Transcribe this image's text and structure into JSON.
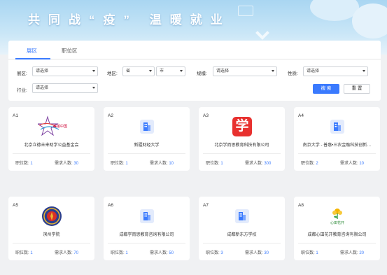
{
  "banner": {
    "slogan": "共同战“疫” 温暖就业"
  },
  "tabs": [
    {
      "label": "展区"
    },
    {
      "label": "职位区"
    }
  ],
  "filters": {
    "zone_label": "展区:",
    "zone_value": "请选择",
    "region_label": "地区:",
    "province_value": "省",
    "city_value": "市",
    "scale_label": "规模:",
    "scale_value": "请选择",
    "nature_label": "性质:",
    "nature_value": "请选择",
    "industry_label": "行业:",
    "industry_value": "请选择"
  },
  "buttons": {
    "search": "搜 索",
    "reset": "重 置"
  },
  "stat_labels": {
    "positions": "职位数:",
    "demand": "需求人数:"
  },
  "cards": [
    {
      "code": "A1",
      "name": "北京立德未来助学公益基金会",
      "positions": "1",
      "demand": "30",
      "logo": "star-logo"
    },
    {
      "code": "A2",
      "name": "新疆财经大学",
      "positions": "1",
      "demand": "10",
      "logo": "building-icon"
    },
    {
      "code": "A3",
      "name": "北京学而思教育科技有限公司",
      "positions": "1",
      "demand": "300",
      "logo": "xue-logo"
    },
    {
      "code": "A4",
      "name": "南京大学 - 普惠•三农金融科技创新…",
      "positions": "2",
      "demand": "10",
      "logo": "building-icon"
    },
    {
      "code": "A5",
      "name": "滨州学院",
      "positions": "1",
      "demand": "70",
      "logo": "emblem-logo"
    },
    {
      "code": "A6",
      "name": "成都学而思教育咨询有限公司",
      "positions": "1",
      "demand": "50",
      "logo": "building-icon"
    },
    {
      "code": "A7",
      "name": "成都新东方学校",
      "positions": "3",
      "demand": "30",
      "logo": "building-icon"
    },
    {
      "code": "A8",
      "name": "成都心田花开教育咨询有限公司",
      "positions": "1",
      "demand": "20",
      "logo": "flower-logo"
    }
  ],
  "logo_texts": {
    "star": "美丽中国",
    "xue": "学",
    "flower": "心田花开"
  },
  "colors": {
    "accent": "#3a7afe",
    "xue_red": "#e8312f"
  }
}
